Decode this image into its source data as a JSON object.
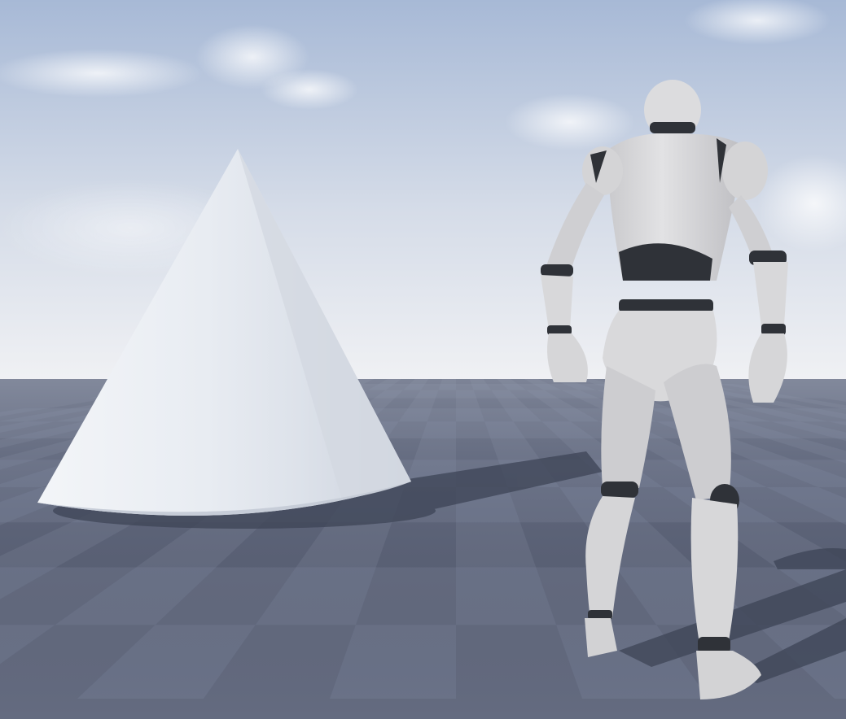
{
  "scene": {
    "description_label": "",
    "sky_top_color": "#a9bcd9",
    "sky_horizon_color": "#eef0f4",
    "floor_light_color": "#6b7389",
    "floor_dark_color": "#596075",
    "mannequin_color": "#d6d6d8",
    "mannequin_joint_color": "#2f3238",
    "cone_color": "#e9edf3",
    "shadow_color": "#3a4152"
  },
  "objects": [
    {
      "name": "cone",
      "icon": "cone-shape"
    },
    {
      "name": "mannequin",
      "icon": "humanoid-figure"
    }
  ]
}
